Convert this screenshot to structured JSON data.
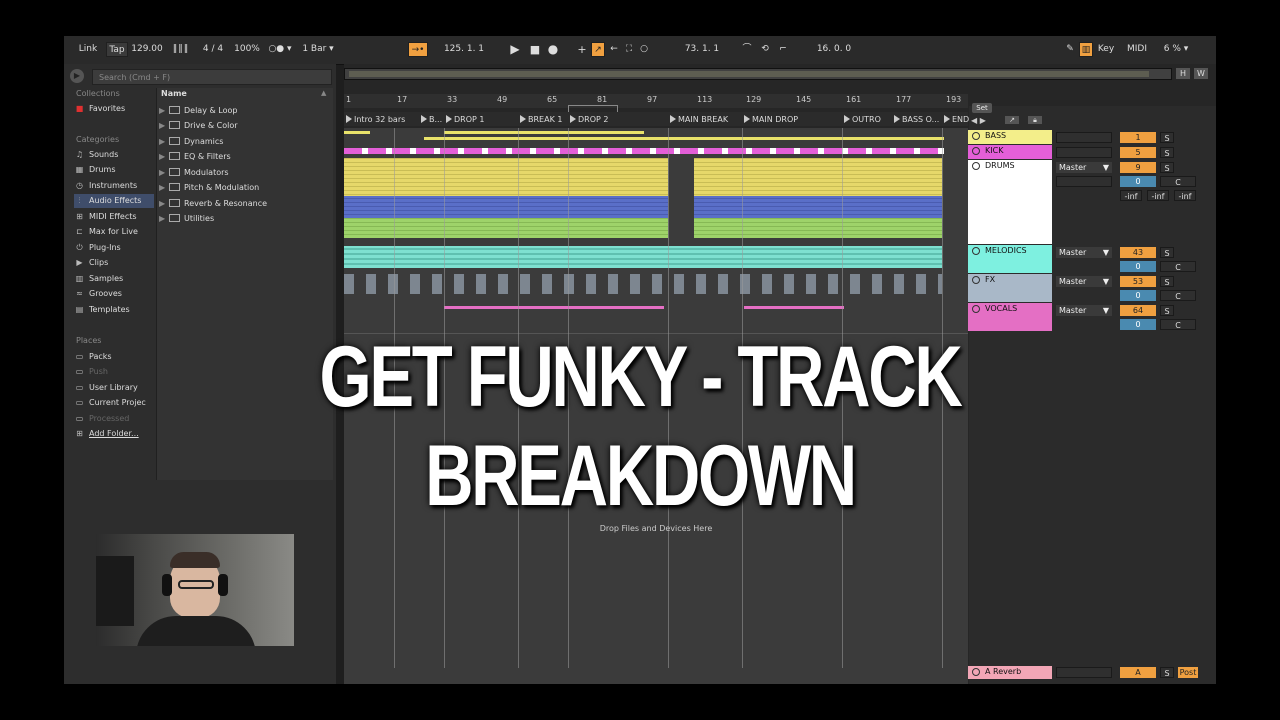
{
  "transport": {
    "link": "Link",
    "tap": "Tap",
    "bpm": "129.00",
    "meter": "4 / 4",
    "zoom": "100%",
    "quant": "1 Bar",
    "position": "125.  1.  1",
    "loop_start": "73.  1.  1",
    "loop_length": "16.  0.  0",
    "key": "Key",
    "midi": "MIDI",
    "cpu": "6 %"
  },
  "browser": {
    "search_placeholder": "Search (Cmd + F)",
    "collections_heading": "Collections",
    "favorites": "Favorites",
    "categories_heading": "Categories",
    "categories": [
      "Sounds",
      "Drums",
      "Instruments",
      "Audio Effects",
      "MIDI Effects",
      "Max for Live",
      "Plug-Ins",
      "Clips",
      "Samples",
      "Grooves",
      "Templates"
    ],
    "places_heading": "Places",
    "places": [
      "Packs",
      "Push",
      "User Library",
      "Current Projec",
      "Processed",
      "Add Folder..."
    ],
    "name_header": "Name",
    "folders": [
      "Delay & Loop",
      "Drive & Color",
      "Dynamics",
      "EQ & Filters",
      "Modulators",
      "Pitch & Modulation",
      "Reverb & Resonance",
      "Utilities"
    ]
  },
  "arrangement": {
    "bars": [
      "1",
      "17",
      "33",
      "49",
      "65",
      "81",
      "97",
      "113",
      "129",
      "145",
      "161",
      "177",
      "193"
    ],
    "locators": [
      "Intro 32 bars",
      "B...",
      "DROP 1",
      "BREAK 1",
      "DROP 2",
      "MAIN BREAK",
      "MAIN DROP",
      "OUTRO",
      "BASS O...",
      "END"
    ],
    "drop_hint": "Drop Files and Devices Here",
    "set_label": "Set",
    "hw_h": "H",
    "hw_w": "W"
  },
  "tracks": [
    {
      "name": "BASS",
      "color": "#f3ee8a",
      "vol": "1",
      "output": ""
    },
    {
      "name": "KICK",
      "color": "#e45fd8",
      "vol": "5",
      "output": ""
    },
    {
      "name": "DRUMS",
      "color": "#ffffff",
      "vol": "9",
      "output": "Master",
      "pan": "0",
      "pan_c": "C",
      "inf": "-inf"
    },
    {
      "name": "MELODICS",
      "color": "#7ef0e0",
      "vol": "43",
      "output": "Master",
      "pan": "0",
      "pan_c": "C"
    },
    {
      "name": "FX",
      "color": "#a9b8c8",
      "vol": "53",
      "output": "Master",
      "pan": "0",
      "pan_c": "C"
    },
    {
      "name": "VOCALS",
      "color": "#e46fc4",
      "vol": "64",
      "output": "Master",
      "pan": "0",
      "pan_c": "C"
    }
  ],
  "solo": "S",
  "return_track": {
    "name": "A Reverb",
    "send": "A",
    "post": "Post",
    "color": "#f2a6b6"
  },
  "overlay_title": "GET FUNKY - TRACK BREAKDOWN"
}
